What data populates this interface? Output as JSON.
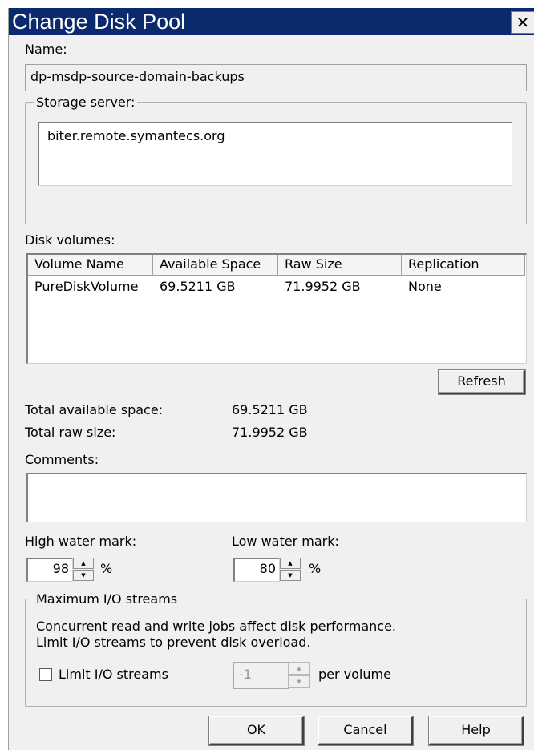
{
  "dialog": {
    "title": "Change Disk Pool",
    "close_glyph": "✕"
  },
  "name": {
    "label": "Name:",
    "value": "dp-msdp-source-domain-backups"
  },
  "storage_server": {
    "legend": "Storage server:",
    "value": "biter.remote.symantecs.org"
  },
  "disk_volumes": {
    "label": "Disk volumes:",
    "columns": [
      "Volume Name",
      "Available Space",
      "Raw Size",
      "Replication"
    ],
    "rows": [
      [
        "PureDiskVolume",
        "69.5211 GB",
        "71.9952 GB",
        "None"
      ]
    ]
  },
  "refresh_label": "Refresh",
  "totals": {
    "available_label": "Total available space:",
    "available_value": "69.5211 GB",
    "raw_label": "Total raw size:",
    "raw_value": "71.9952 GB"
  },
  "comments": {
    "label": "Comments:",
    "value": ""
  },
  "water_marks": {
    "high_label": "High water mark:",
    "high_value": "98",
    "low_label": "Low water mark:",
    "low_value": "80",
    "unit": "%"
  },
  "io_streams": {
    "legend": "Maximum I/O streams",
    "description_line1": "Concurrent read and write jobs affect disk performance.",
    "description_line2": "Limit I/O streams to prevent disk overload.",
    "checkbox_label": "Limit I/O streams",
    "checked": false,
    "value": "-1",
    "per_label": "per volume"
  },
  "buttons": {
    "ok": "OK",
    "cancel": "Cancel",
    "help": "Help"
  }
}
